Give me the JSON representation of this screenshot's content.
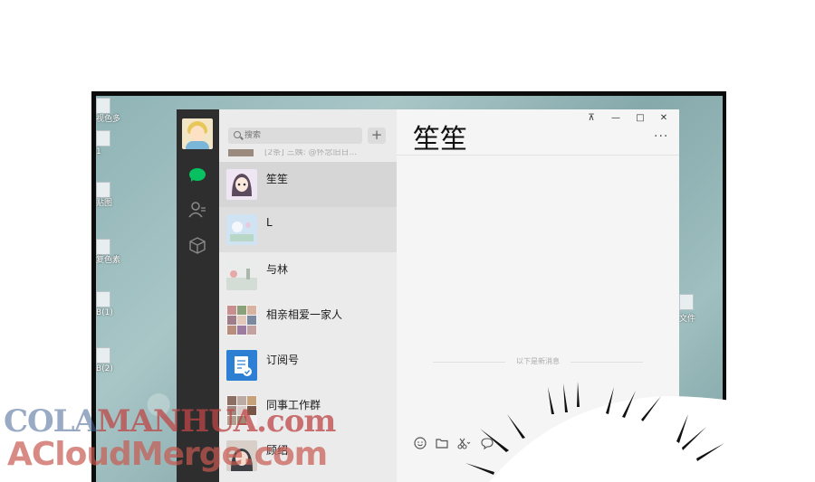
{
  "desktop": {
    "left_icons": [
      {
        "label": "视色多"
      },
      {
        "label": "1"
      },
      {
        "label": "贴图"
      },
      {
        "label": "复色素"
      },
      {
        "label": "B(1)"
      },
      {
        "label": "B(2)"
      }
    ],
    "right_icon_label": "文件"
  },
  "search": {
    "placeholder": "搜索"
  },
  "list": {
    "partial_top_text": "[2条] 三姨: @怀念旧日...",
    "chats": [
      {
        "name": "笙笙"
      },
      {
        "name": "L"
      },
      {
        "name": "与林"
      },
      {
        "name": "相亲相爱一家人"
      },
      {
        "name": "订阅号"
      },
      {
        "name": "同事工作群"
      },
      {
        "name": "顾绍"
      }
    ]
  },
  "chat": {
    "title": "笙笙",
    "divider_text": "以下是新消息",
    "more_label": "···"
  },
  "window_controls": {
    "pin": "⊼",
    "minimize": "—",
    "maximize": "□",
    "close": "✕"
  },
  "watermark": {
    "line1_a": "COLA",
    "line1_b": "MANHUA.com",
    "line2": "ACloudMerge.com"
  },
  "colors": {
    "accent": "#07c160",
    "nav_bg": "#2e2e2e",
    "list_bg": "#ebebeb",
    "chat_bg": "#f5f5f5"
  }
}
